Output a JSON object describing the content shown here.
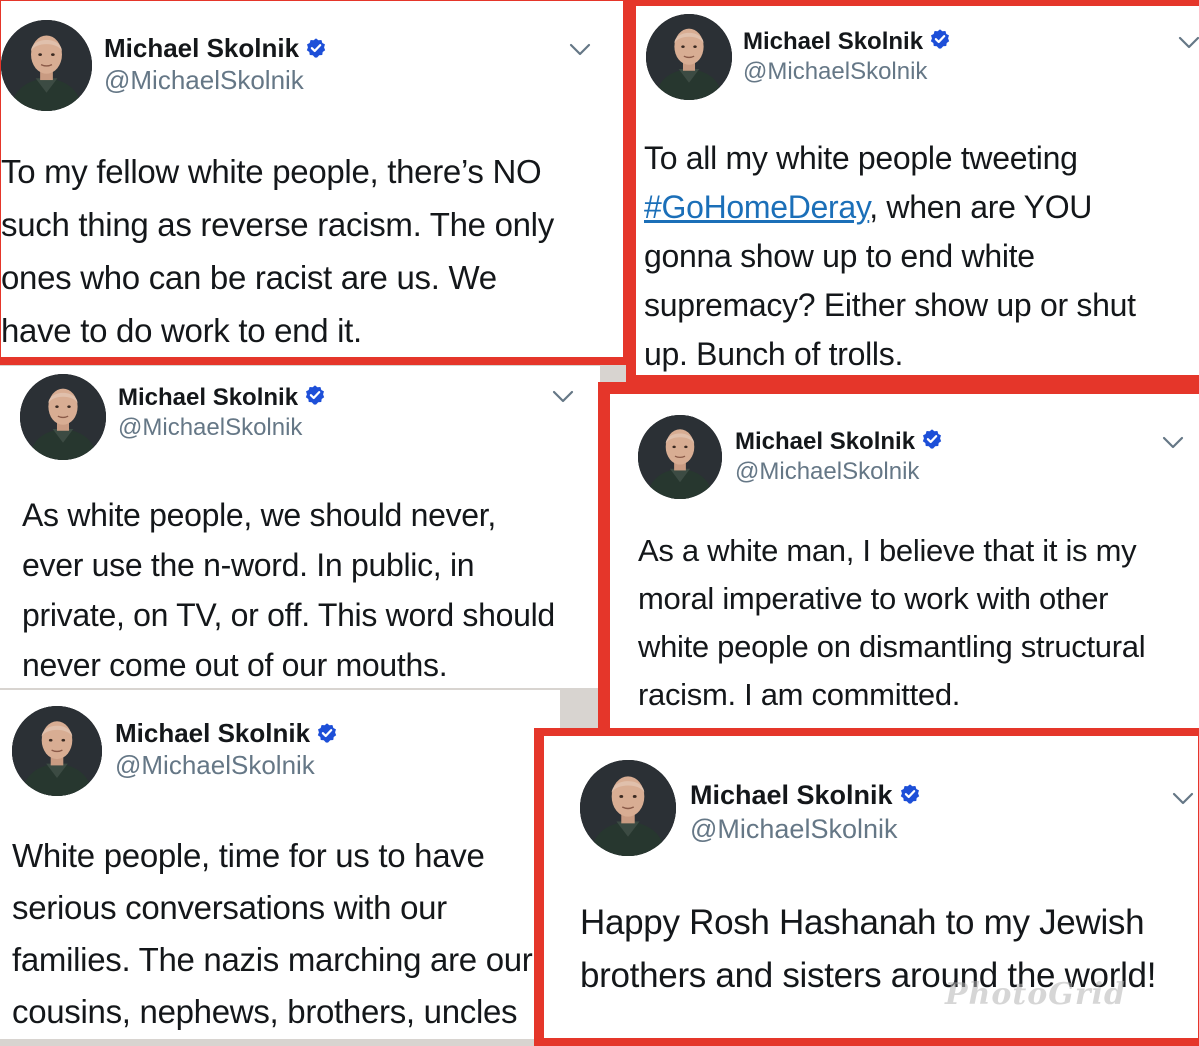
{
  "tweets": [
    {
      "name": "Michael Skolnik",
      "handle": "@MichaelSkolnik",
      "lines": [
        "To my fellow white people, there’s NO",
        "such thing as reverse racism. The only",
        "ones who can be racist are us. We",
        "have to do work to end it."
      ]
    },
    {
      "name": "Michael Skolnik",
      "handle": "@MichaelSkolnik",
      "line1_pre": "To all my white people tweeting",
      "hashtag": "#GoHomeDeray",
      "line2_post": ", when are YOU",
      "lines_rest": [
        "gonna show up to end white",
        "supremacy? Either show up or shut",
        "up. Bunch of trolls."
      ]
    },
    {
      "name": "Michael Skolnik",
      "handle": "@MichaelSkolnik",
      "lines": [
        "As white people, we should never,",
        "ever use the n-word. In public, in",
        "private, on TV, or off. This word should",
        "never come out of our mouths."
      ]
    },
    {
      "name": "Michael Skolnik",
      "handle": "@MichaelSkolnik",
      "lines": [
        "As a white man, I believe that it is my",
        "moral imperative to work with other",
        "white people on dismantling structural",
        "racism. I am committed."
      ]
    },
    {
      "name": "Michael Skolnik",
      "handle": "@MichaelSkolnik",
      "lines": [
        "White people, time for us to have",
        "serious conversations with our",
        "families. The nazis marching are our",
        "cousins, nephews, brothers, uncles"
      ]
    },
    {
      "name": "Michael Skolnik",
      "handle": "@MichaelSkolnik",
      "lines": [
        "Happy Rosh Hashanah to my Jewish",
        "brothers and sisters around the world!"
      ]
    }
  ],
  "watermark": "PhotoGrid",
  "colors": {
    "frame": "#e5362a",
    "verified": "#1d4fd8",
    "hashtag": "#1b6fb8"
  },
  "icons": {
    "verified": "verified-badge-icon",
    "menu": "chevron-down-icon"
  }
}
